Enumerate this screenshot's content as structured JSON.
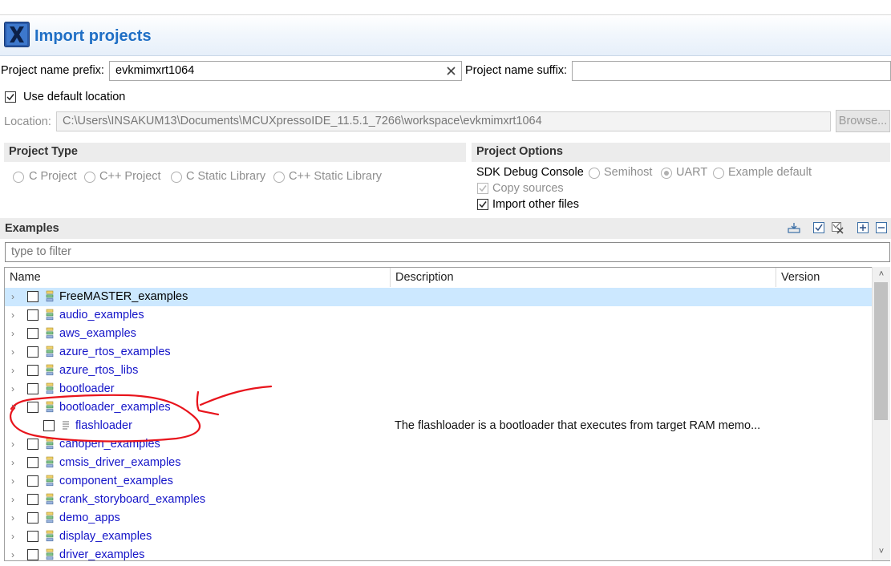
{
  "window": {
    "title": "Import projects"
  },
  "naming": {
    "prefix_label": "Project name prefix:",
    "prefix_value": "evkmimxrt1064",
    "suffix_label": "Project name suffix:",
    "suffix_value": ""
  },
  "location": {
    "use_default_label": "Use default location",
    "use_default_checked": true,
    "label": "Location:",
    "path": "C:\\Users\\INSAKUM13\\Documents\\MCUXpressoIDE_11.5.1_7266\\workspace\\evkmimxrt1064",
    "browse_label": "Browse..."
  },
  "project_type": {
    "title": "Project Type",
    "options": [
      "C Project",
      "C++ Project",
      "C Static Library",
      "C++ Static Library"
    ]
  },
  "project_options": {
    "title": "Project Options",
    "sdk_debug_console_label": "SDK Debug Console",
    "console_options": [
      "Semihost",
      "UART",
      "Example default"
    ],
    "console_selected": "UART",
    "copy_sources_label": "Copy sources",
    "copy_sources_checked": true,
    "import_other_label": "Import other files",
    "import_other_checked": true
  },
  "examples": {
    "title": "Examples",
    "filter_placeholder": "type to filter",
    "columns": [
      "Name",
      "Description",
      "Version"
    ],
    "toolbar_icons": [
      "import-icon",
      "select-all-icon",
      "deselect-all-icon",
      "expand-all-icon",
      "collapse-all-icon"
    ],
    "rows": [
      {
        "label": "FreeMASTER_examples",
        "description": "",
        "selected": true
      },
      {
        "label": "audio_examples",
        "description": ""
      },
      {
        "label": "aws_examples",
        "description": ""
      },
      {
        "label": "azure_rtos_examples",
        "description": ""
      },
      {
        "label": "azure_rtos_libs",
        "description": ""
      },
      {
        "label": "bootloader",
        "description": ""
      },
      {
        "label": "bootloader_examples",
        "description": "",
        "expanded": true
      },
      {
        "label": "flashloader",
        "description": "The flashloader is a bootloader that executes from target RAM memo...",
        "child": true
      },
      {
        "label": "canopen_examples",
        "description": ""
      },
      {
        "label": "cmsis_driver_examples",
        "description": ""
      },
      {
        "label": "component_examples",
        "description": ""
      },
      {
        "label": "crank_storyboard_examples",
        "description": ""
      },
      {
        "label": "demo_apps",
        "description": ""
      },
      {
        "label": "display_examples",
        "description": ""
      },
      {
        "label": "driver_examples",
        "description": ""
      }
    ]
  },
  "colors": {
    "title_blue": "#1f6fc5",
    "link_blue": "#1414c8",
    "selection": "#cce8ff",
    "annotation_red": "#e8141c"
  }
}
